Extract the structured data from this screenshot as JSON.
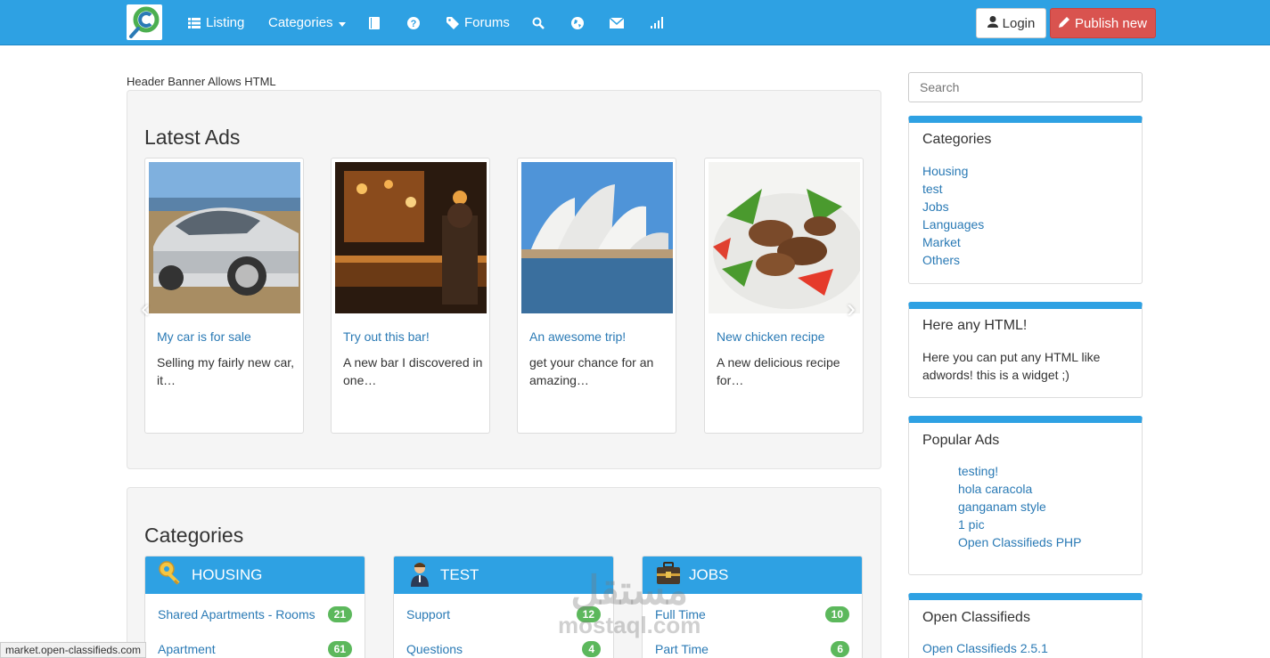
{
  "nav": {
    "listing": "Listing",
    "categories": "Categories",
    "forums": "Forums",
    "login": "Login",
    "publish": "Publish new",
    "icons": [
      "list-icon",
      "book-icon",
      "question-icon",
      "tag-icon",
      "search-icon",
      "globe-icon",
      "envelope-icon",
      "signal-icon"
    ]
  },
  "banner": "Header Banner Allows HTML",
  "latest": {
    "title": "Latest Ads",
    "ads": [
      {
        "title": "My car is for sale",
        "desc": "Selling my fairly new car, it…"
      },
      {
        "title": "Try out this bar!",
        "desc": "A new bar I discovered in one…"
      },
      {
        "title": "An awesome trip!",
        "desc": "get your chance for an amazing…"
      },
      {
        "title": "New chicken recipe",
        "desc": "A new delicious recipe for…"
      }
    ]
  },
  "categories_section": {
    "title": "Categories",
    "boxes": [
      {
        "name": "HOUSING",
        "rows": [
          {
            "label": "Shared Apartments - Rooms",
            "count": "21"
          },
          {
            "label": "Apartment",
            "count": "61"
          }
        ]
      },
      {
        "name": "TEST",
        "rows": [
          {
            "label": "Support",
            "count": "12"
          },
          {
            "label": "Questions",
            "count": "4"
          }
        ]
      },
      {
        "name": "JOBS",
        "rows": [
          {
            "label": "Full Time",
            "count": "10"
          },
          {
            "label": "Part Time",
            "count": "6"
          }
        ]
      }
    ]
  },
  "sidebar": {
    "search_placeholder": "Search",
    "categories_title": "Categories",
    "categories": [
      "Housing",
      "test",
      "Jobs",
      "Languages",
      "Market",
      "Others"
    ],
    "html_title": "Here any HTML!",
    "html_text": "Here you can put any HTML like adwords! this is a widget ;)",
    "popular_title": "Popular Ads",
    "popular": [
      "testing!",
      "hola caracola",
      "ganganam style",
      "1 pic",
      "Open Classifieds PHP"
    ],
    "oc_title": "Open Classifieds",
    "oc_link": "Open Classifieds 2.5.1"
  },
  "status_url": "market.open-classifieds.com",
  "watermark": {
    "arabic": "مستقل",
    "latin": "mostaql.com"
  },
  "colors": {
    "nav": "#2ea1e3",
    "publish": "#d9534f",
    "badge": "#5cb85c",
    "link": "#2a7ab5"
  }
}
